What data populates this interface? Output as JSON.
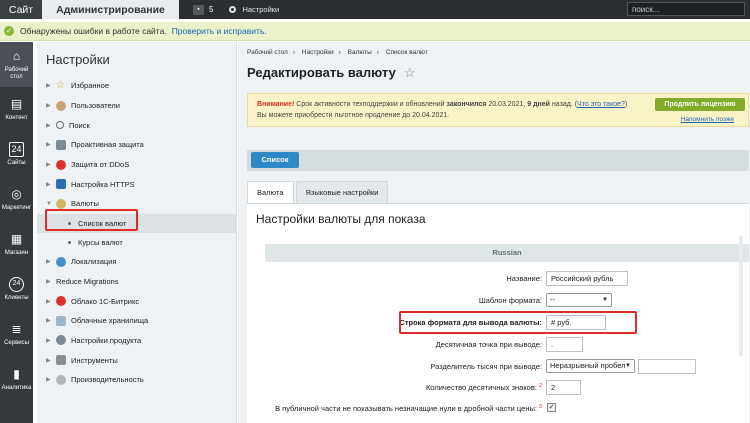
{
  "topbar": {
    "site_tab": "Сайт",
    "admin_tab": "Администрирование",
    "notif_count": "5",
    "settings_label": "Настройки",
    "search_placeholder": "поиск..."
  },
  "errbar": {
    "message": "Обнаружены ошибки в работе сайта.",
    "link": "Проверить и исправить."
  },
  "leftnav": [
    {
      "label": "Рабочий стол",
      "icon": "home-icon"
    },
    {
      "label": "Контент",
      "icon": "document-icon"
    },
    {
      "label": "Сайты",
      "icon": "calendar-icon"
    },
    {
      "label": "Маркетинг",
      "icon": "target-icon"
    },
    {
      "label": "Магазин",
      "icon": "store-icon"
    },
    {
      "label": "Клиенты",
      "icon": "clients-icon"
    },
    {
      "label": "Сервисы",
      "icon": "layers-icon"
    },
    {
      "label": "Аналитика",
      "icon": "chart-icon"
    }
  ],
  "sidebar": {
    "title": "Настройки",
    "items": [
      {
        "label": "Избранное",
        "icon": "star-icon"
      },
      {
        "label": "Пользователи",
        "icon": "user-icon"
      },
      {
        "label": "Поиск",
        "icon": "search-icon"
      },
      {
        "label": "Проактивная защита",
        "icon": "shield-icon"
      },
      {
        "label": "Защита от DDoS",
        "icon": "ddos-icon"
      },
      {
        "label": "Настройка HTTPS",
        "icon": "https-icon"
      },
      {
        "label": "Валюты",
        "icon": "currency-icon"
      },
      {
        "label": "Список валют"
      },
      {
        "label": "Курсы валют"
      },
      {
        "label": "Локализация",
        "icon": "globe-icon"
      },
      {
        "label": "Reduce Migrations"
      },
      {
        "label": "Облако 1С-Битрикс",
        "icon": "cloud-icon"
      },
      {
        "label": "Облачные хранилища",
        "icon": "storage-icon"
      },
      {
        "label": "Настройки продукта",
        "icon": "gear-icon"
      },
      {
        "label": "Инструменты",
        "icon": "tools-icon"
      },
      {
        "label": "Производительность",
        "icon": "performance-icon"
      }
    ]
  },
  "main": {
    "breadcrumbs": [
      "Рабочий стол",
      "Настройки",
      "Валюты",
      "Список валют"
    ],
    "title": "Редактировать валюту",
    "warning": {
      "attention": "Внимание!",
      "text1": "Срок активности техподдержки и обновлений",
      "ended": "закончился",
      "date1": "20.03.2021,",
      "days": "9 дней",
      "ago": "назад.",
      "what_link": "Что это такое?",
      "text2": "Вы можете приобрести льготное продление до 20.04.2021.",
      "license_button": "Продлить лицензию",
      "remind_later": "Напомнить позже"
    },
    "list_button": "Список",
    "tabs": [
      "Валюта",
      "Языковые настройки"
    ],
    "panel_title": "Настройки валюты для показа",
    "language_header": "Russian",
    "fields": {
      "name_label": "Название:",
      "name_value": "Российский рубль",
      "template_label": "Шаблон формата:",
      "template_value": "--",
      "format_label": "Строка формата для вывода валюты:",
      "format_value": "# руб.",
      "decimal_label": "Десятичная точка при выводе:",
      "decimal_value": ".",
      "thousands_label": "Разделитель тысяч при выводе:",
      "thousands_value": "Неразрывный пробел",
      "decimals_label": "Количество десятичных знаков:",
      "decimals_sup": "2",
      "decimals_value": "2",
      "zeros_label": "В публичной части не показывать незначащие нули в дробной части цены:",
      "zeros_sup": "3"
    }
  }
}
